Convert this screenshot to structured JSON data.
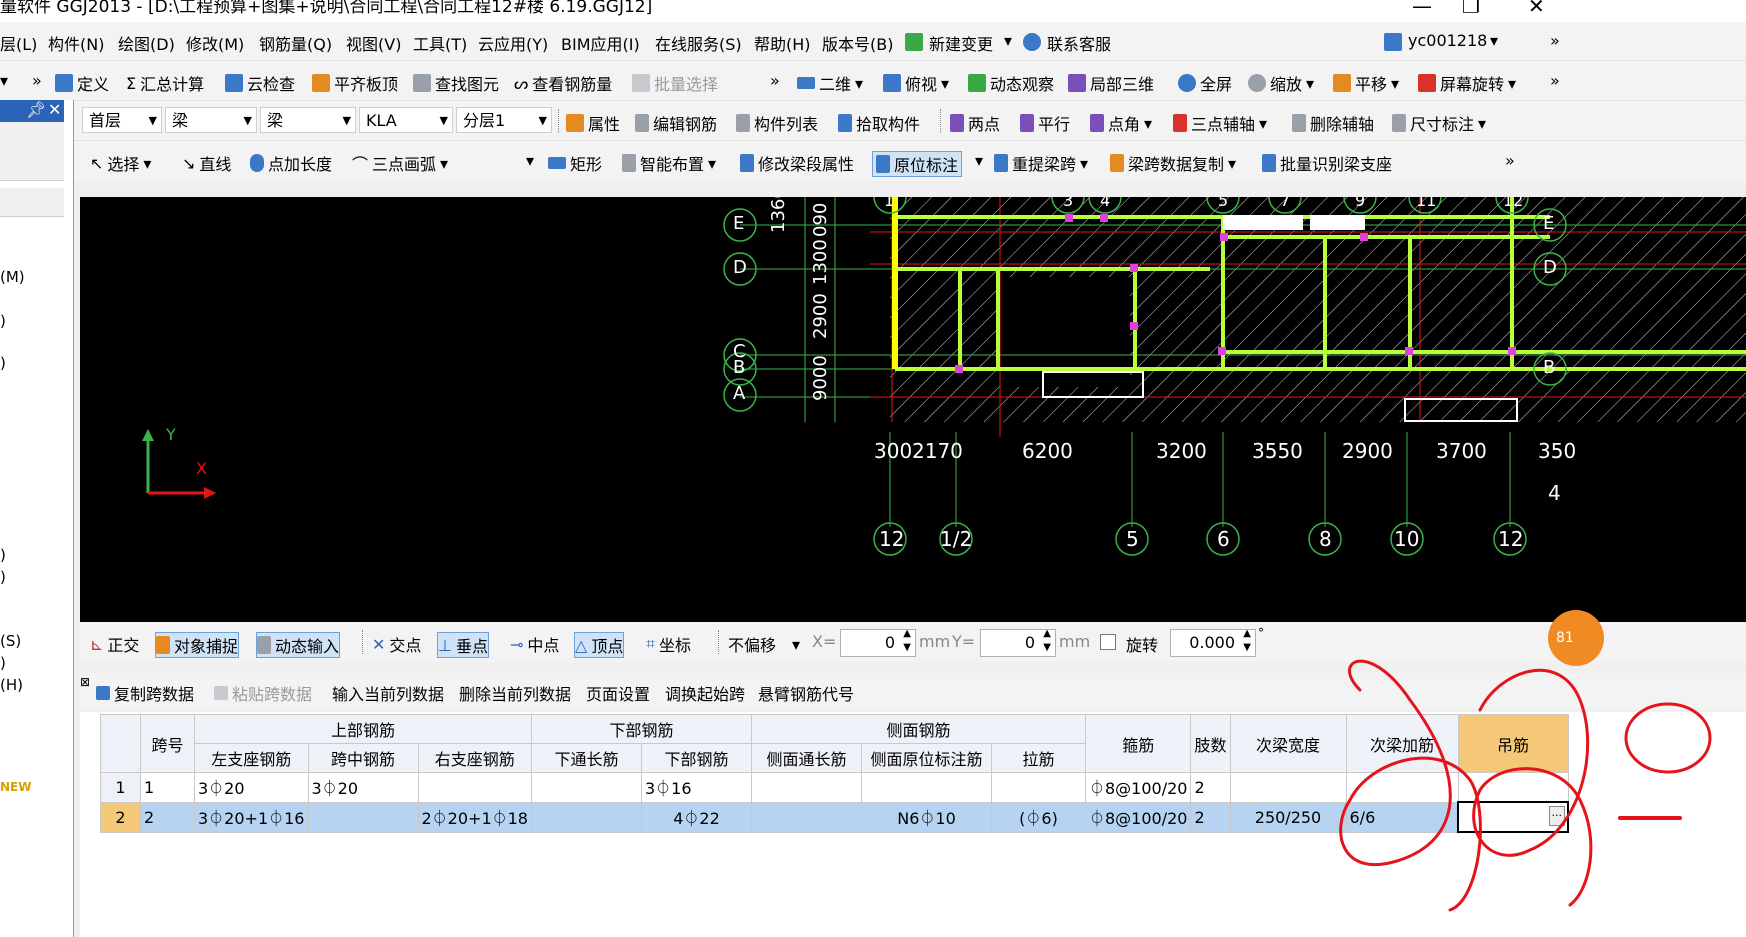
{
  "window": {
    "title": "量软件 GGJ2013 - [D:\\工程预算+图集+说明\\合同工程\\合同工程12#楼 6.19.GGJ12]"
  },
  "menu": [
    "层(L)",
    "构件(N)",
    "绘图(D)",
    "修改(M)",
    "钢筋量(Q)",
    "视图(V)",
    "工具(T)",
    "云应用(Y)",
    "BIM应用(I)",
    "在线服务(S)",
    "帮助(H)",
    "版本号(B)",
    "新建变更",
    "联系客服"
  ],
  "user": "yc001218",
  "toolbar1": [
    "定义",
    "汇总计算",
    "云检查",
    "平齐板顶",
    "查找图元",
    "查看钢筋量",
    "批量选择",
    "二维",
    "俯视",
    "动态观察",
    "局部三维",
    "全屏",
    "缩放",
    "平移",
    "屏幕旋转"
  ],
  "toolbar2": {
    "floor": "首层",
    "type1": "梁",
    "type2": "梁",
    "element": "KLA",
    "layer": "分层1",
    "buttons": [
      "属性",
      "编辑钢筋",
      "构件列表",
      "拾取构件",
      "两点",
      "平行",
      "点角",
      "三点辅轴",
      "删除辅轴",
      "尺寸标注"
    ]
  },
  "toolbar3": [
    "选择",
    "直线",
    "点加长度",
    "三点画弧",
    "矩形",
    "智能布置",
    "修改梁段属性",
    "原位标注",
    "重提梁跨",
    "梁跨数据复制",
    "批量识别梁支座"
  ],
  "left_panel": {
    "items": [
      "(M)",
      ")",
      ")",
      ")",
      ")",
      "(S)",
      ")",
      "(H)",
      "NEW"
    ]
  },
  "canvas": {
    "axis_y": "Y",
    "axis_x": "X",
    "row_labels": [
      "E",
      "D",
      "C",
      "B",
      "A"
    ],
    "left_dims": [
      "13600",
      "090",
      "1300",
      "2900",
      "9000"
    ],
    "top_labels": [
      "1",
      "3",
      "4",
      "5",
      "7",
      "9",
      "11",
      "12"
    ],
    "bottom_dims": [
      "300",
      "2170",
      "6200",
      "3200",
      "3550",
      "2900",
      "3700",
      "350"
    ],
    "bottom_labels": [
      "12",
      "1/2",
      "5",
      "6",
      "8",
      "10",
      "12"
    ],
    "edge_num": "4"
  },
  "snapbar": {
    "buttons": [
      "正交",
      "对象捕捉",
      "动态输入",
      "交点",
      "垂点",
      "中点",
      "顶点",
      "坐标"
    ],
    "offset": "不偏移",
    "x_label": "X=",
    "x_value": "0",
    "y_label": "Y=",
    "y_value": "0",
    "unit": "mm",
    "rotate_label": "旋转",
    "rotate_value": "0.000",
    "degree": "°",
    "badge": "81"
  },
  "grid_toolbar": [
    "复制跨数据",
    "粘贴跨数据",
    "输入当前列数据",
    "删除当前列数据",
    "页面设置",
    "调换起始跨",
    "悬臂钢筋代号"
  ],
  "grid": {
    "group_headers": {
      "span": "跨号",
      "top": "上部钢筋",
      "bottom": "下部钢筋",
      "side": "侧面钢筋",
      "stirrup": "箍筋",
      "legs": "肢数",
      "sec_width": "次梁宽度",
      "sec_add": "次梁加筋",
      "hanger": "吊筋"
    },
    "sub_headers": [
      "左支座钢筋",
      "跨中钢筋",
      "右支座钢筋",
      "下通长筋",
      "下部钢筋",
      "侧面通长筋",
      "侧面原位标注筋",
      "拉筋"
    ],
    "rows": [
      {
        "idx": "1",
        "span": "1",
        "left": "3⏀20",
        "mid": "3⏀20",
        "right": "",
        "bot_through": "",
        "bottom": "3⏀16",
        "side_through": "",
        "side_in": "",
        "tie": "",
        "stirrup": "⏀8@100/20",
        "legs": "2",
        "sec_width": "",
        "sec_add": "",
        "hanger": ""
      },
      {
        "idx": "2",
        "span": "2",
        "left": "3⏀20+1⏀16",
        "mid": "",
        "right": "2⏀20+1⏀18",
        "bot_through": "",
        "bottom": "4⏀22",
        "side_through": "",
        "side_in": "N6⏀10",
        "tie": "(⏀6)",
        "stirrup": "⏀8@100/20",
        "legs": "2",
        "sec_width": "250/250",
        "sec_add": "6/6",
        "hanger": ""
      }
    ],
    "ellipsis": "···"
  },
  "colors": {
    "canvas_bg": "#000000",
    "selected_row": "#b7d3f2",
    "hanger_header": "#f5c878",
    "annotation": "#e4141b"
  }
}
